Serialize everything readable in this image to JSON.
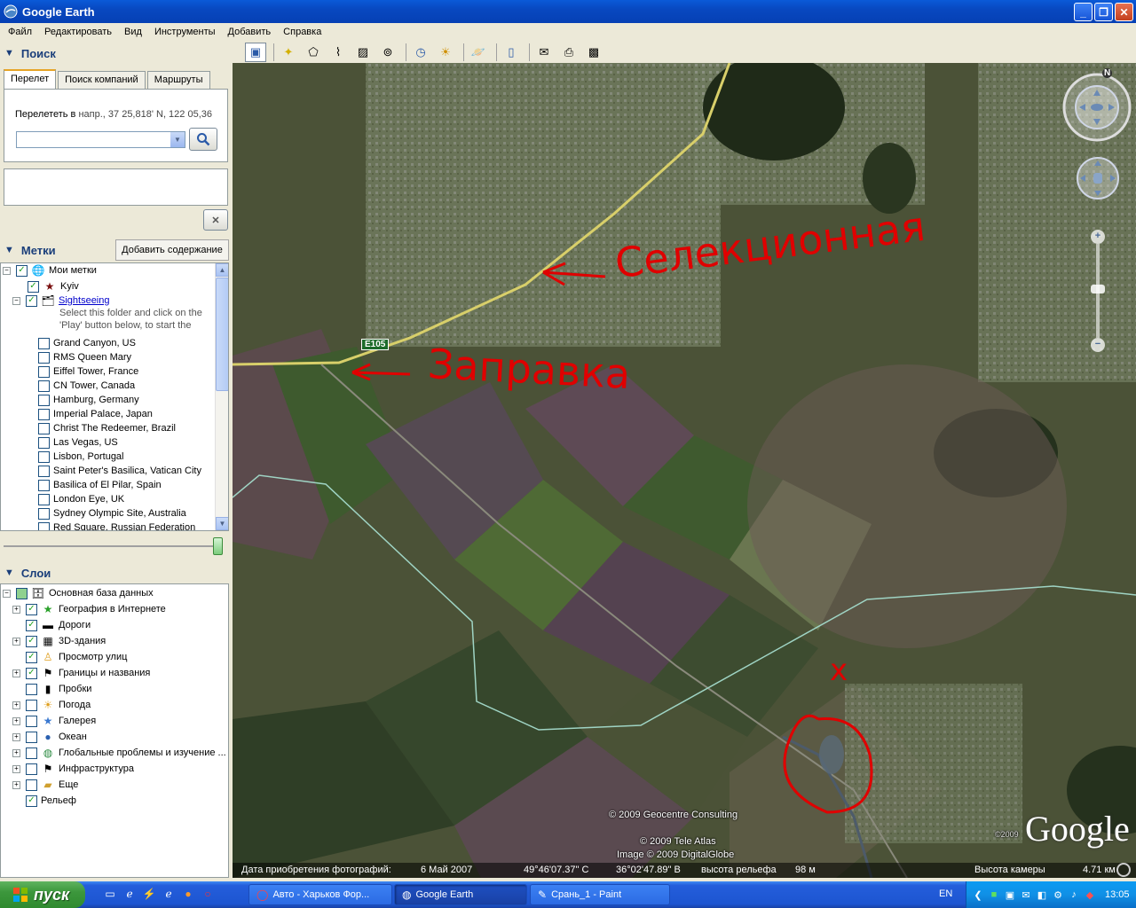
{
  "window": {
    "title": "Google Earth"
  },
  "menu": [
    "Файл",
    "Редактировать",
    "Вид",
    "Инструменты",
    "Добавить",
    "Справка"
  ],
  "search": {
    "header": "Поиск",
    "tabs": [
      "Перелет",
      "Поиск компаний",
      "Маршруты"
    ],
    "fly_label": "Перелететь в",
    "fly_hint": "напр., 37 25,818' N, 122 05,36",
    "input_value": ""
  },
  "places": {
    "header": "Метки",
    "add_content": "Добавить содержание",
    "root": "Мои метки",
    "items": [
      {
        "label": "Kyiv",
        "checked": true
      },
      {
        "label": "Sightseeing",
        "checked": true,
        "desc1": "Select this folder and click on the",
        "desc2": "'Play' button below, to start the"
      },
      {
        "label": "Grand Canyon, US"
      },
      {
        "label": "RMS Queen Mary"
      },
      {
        "label": "Eiffel Tower, France"
      },
      {
        "label": "CN Tower, Canada"
      },
      {
        "label": "Hamburg, Germany"
      },
      {
        "label": "Imperial Palace, Japan"
      },
      {
        "label": "Christ The Redeemer, Brazil"
      },
      {
        "label": "Las Vegas, US"
      },
      {
        "label": "Lisbon, Portugal"
      },
      {
        "label": "Saint Peter's Basilica, Vatican City"
      },
      {
        "label": "Basilica of El Pilar, Spain"
      },
      {
        "label": "London Eye, UK"
      },
      {
        "label": "Sydney Olympic Site, Australia"
      },
      {
        "label": "Red Square, Russian Federation"
      }
    ]
  },
  "layers": {
    "header": "Слои",
    "root": "Основная база данных",
    "items": [
      {
        "label": "География в Интернете",
        "checked": true,
        "icon": "star-icon"
      },
      {
        "label": "Дороги",
        "checked": true,
        "icon": "road-icon"
      },
      {
        "label": "3D-здания",
        "checked": true,
        "icon": "building-icon"
      },
      {
        "label": "Просмотр улиц",
        "checked": true,
        "icon": "pegman-icon"
      },
      {
        "label": "Границы и названия",
        "checked": true,
        "icon": "flag-icon"
      },
      {
        "label": "Пробки",
        "checked": false,
        "icon": "traffic-icon"
      },
      {
        "label": "Погода",
        "checked": false,
        "icon": "sun-icon"
      },
      {
        "label": "Галерея",
        "checked": false,
        "icon": "gallery-icon"
      },
      {
        "label": "Океан",
        "checked": false,
        "icon": "ocean-icon"
      },
      {
        "label": "Глобальные проблемы и изучение ...",
        "checked": false,
        "icon": "globe-icon"
      },
      {
        "label": "Инфраструктура",
        "checked": false,
        "icon": "flag-icon"
      },
      {
        "label": "Еще",
        "checked": false,
        "icon": "folder-icon"
      },
      {
        "label": "Рельеф",
        "checked": true,
        "icon": ""
      }
    ]
  },
  "map": {
    "road_sign": "E105",
    "annotation_1": "Селекционная",
    "annotation_2": "Заправка",
    "annotation_mark": "x",
    "compass_letter": "N",
    "copyright_1": "© 2009 Geocentre Consulting",
    "copyright_2": "© 2009 Tele Atlas",
    "copyright_3": "Image © 2009 DigitalGlobe",
    "copyright_small": "©2009",
    "logo": "Google"
  },
  "status": {
    "date_label": "Дата приобретения фотографий:",
    "date_value": "6 Май 2007",
    "lat": "49°46'07.37\" С",
    "lon": "36°02'47.89\" В",
    "elev_label": "высота рельефа",
    "elev_value": "98 м",
    "cam_label": "Высота камеры",
    "cam_value": "4.71 км"
  },
  "taskbar": {
    "start": "пуск",
    "tasks": [
      {
        "label": "Авто - Харьков Фор...",
        "icon": "opera-icon"
      },
      {
        "label": "Google Earth",
        "icon": "earth-icon"
      },
      {
        "label": "Срань_1 - Paint",
        "icon": "paint-icon"
      }
    ],
    "lang": "EN",
    "clock": "13:05"
  }
}
